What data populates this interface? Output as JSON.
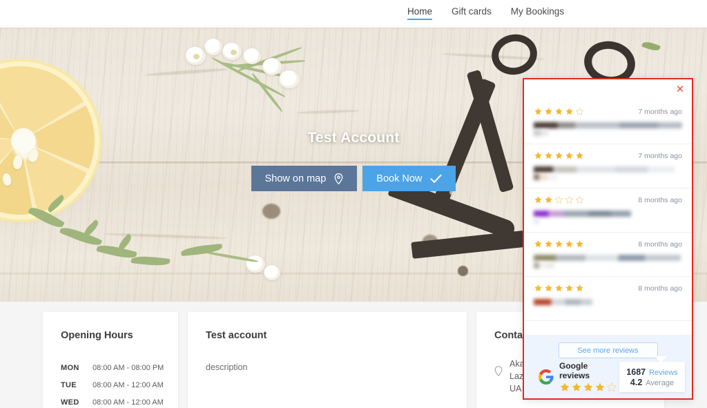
{
  "nav": {
    "items": [
      {
        "label": "Home",
        "active": true
      },
      {
        "label": "Gift cards",
        "active": false
      },
      {
        "label": "My Bookings",
        "active": false
      }
    ]
  },
  "hero": {
    "title": "Test Account",
    "show_on_map_label": "Show on map",
    "show_on_map_icon": "map-pin-icon",
    "book_now_label": "Book Now",
    "book_now_icon": "check-icon",
    "map_button_color": "#5b7699",
    "book_button_color": "#4ba3e8"
  },
  "cards": {
    "opening_hours": {
      "title": "Opening Hours",
      "rows": [
        {
          "day": "MON",
          "time": "08:00 AM - 08:00 PM"
        },
        {
          "day": "TUE",
          "time": "08:00 AM - 12:00 AM"
        },
        {
          "day": "WED",
          "time": "08:00 AM - 12:00 AM"
        }
      ]
    },
    "about": {
      "title": "Test account",
      "description": "description"
    },
    "contact": {
      "title": "Contact",
      "location_icon": "location-pin-icon",
      "address_line_1": "Akademika Yavborna",
      "address_line_2": "Lazare",
      "address_line_3": "UA"
    }
  },
  "reviews_popup": {
    "close_icon": "close-icon",
    "border_color": "#e8271f",
    "star_filled_color": "#f5b731",
    "star_empty_color": "#f5d79a",
    "items": [
      {
        "rating": 4,
        "date": "7 months ago",
        "redacted": true
      },
      {
        "rating": 5,
        "date": "7 months ago",
        "redacted": true
      },
      {
        "rating": 2,
        "date": "8 months ago",
        "redacted": true
      },
      {
        "rating": 5,
        "date": "8 months ago",
        "redacted": true
      },
      {
        "rating": 5,
        "date": "8 months ago",
        "redacted": true
      }
    ],
    "see_more_label": "See more reviews",
    "badge": {
      "icon": "google-logo-icon",
      "title": "Google reviews",
      "stars": 4,
      "reviews_count": "1687",
      "reviews_label": "Reviews",
      "average": "4.2",
      "average_label": "Average"
    }
  }
}
